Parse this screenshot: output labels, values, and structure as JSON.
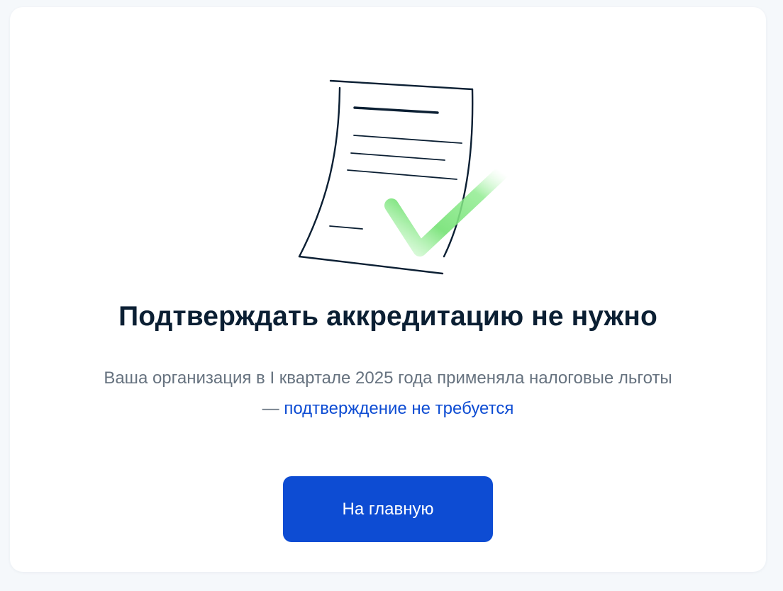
{
  "card": {
    "title": "Подтверждать аккредитацию не нужно",
    "description": {
      "text": "Ваша организация в I квартале 2025 года применяла налоговые льготы",
      "dash": "— ",
      "link": "подтверждение не требуется"
    },
    "button_label": "На главную"
  },
  "illustration": {
    "icon": "document-check-icon",
    "check_color": "#7be37b"
  },
  "colors": {
    "page_bg": "#f5f8fb",
    "card_bg": "#ffffff",
    "title": "#0b1f33",
    "text_secondary": "#66727f",
    "link": "#0d4cd3",
    "button_bg": "#0d4cd3",
    "button_text": "#ffffff"
  }
}
